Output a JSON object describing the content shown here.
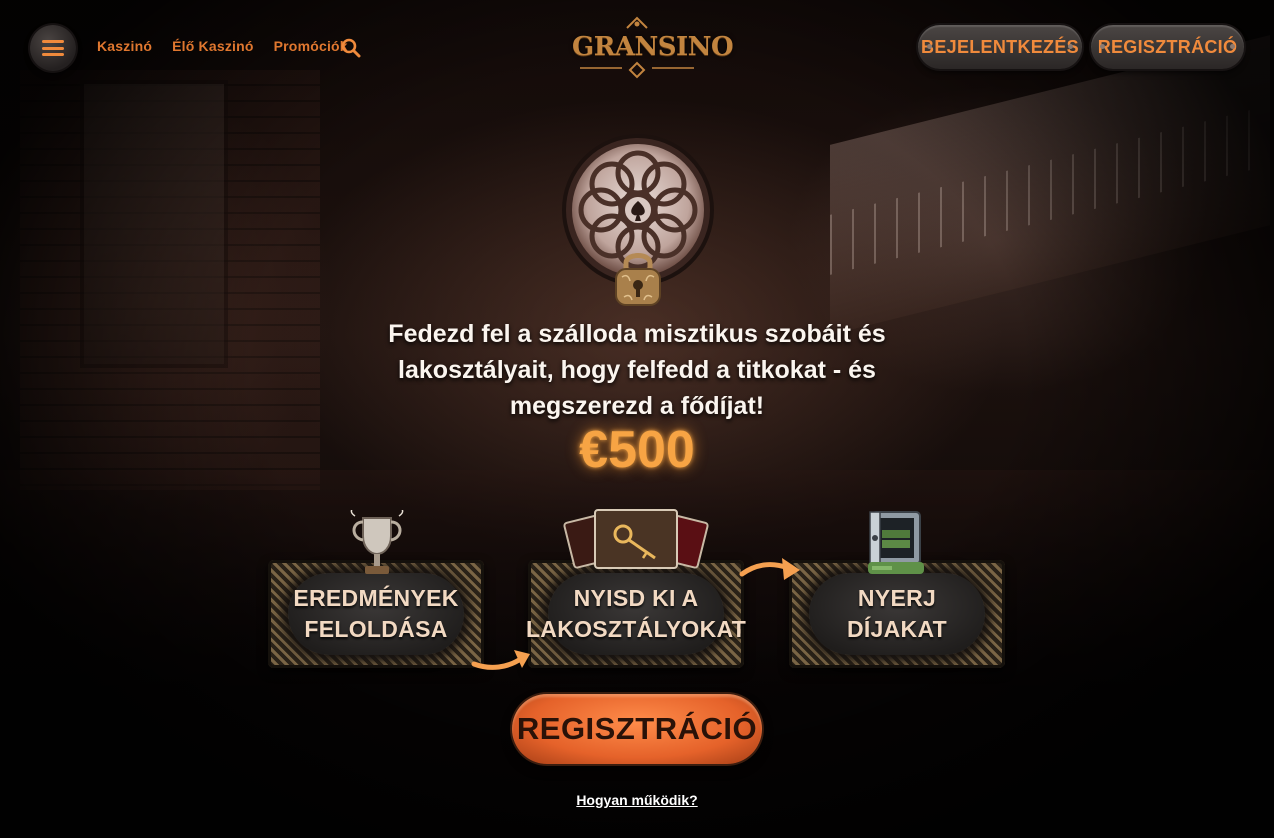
{
  "header": {
    "nav": [
      "Kaszinó",
      "Élő Kaszinó",
      "Promóciók"
    ],
    "logo_text": "GRANSINO",
    "login_label": "BEJELENTKEZÉS",
    "register_label": "REGISZTRÁCIÓ"
  },
  "hero": {
    "headline": "Fedezd fel a szálloda misztikus szobáit és lakosztályait, hogy felfedd a titkokat - és megszerezd a fődíjat!",
    "prize": "€500"
  },
  "steps": [
    {
      "label": "EREDMÉNYEK\nFELOLDÁSA",
      "icon": "trophy-icon"
    },
    {
      "label": "NYISD KI A\nLAKOSZTÁLYOKAT",
      "icon": "cards-icon"
    },
    {
      "label": "NYERJ\nDÍJAKAT",
      "icon": "safe-icon"
    }
  ],
  "cta": {
    "label": "REGISZTRÁCIÓ",
    "how_link": "Hogyan működik?"
  },
  "colors": {
    "accent": "#f08a3c",
    "prize": "#f7a444",
    "cta": "#e5622a"
  }
}
